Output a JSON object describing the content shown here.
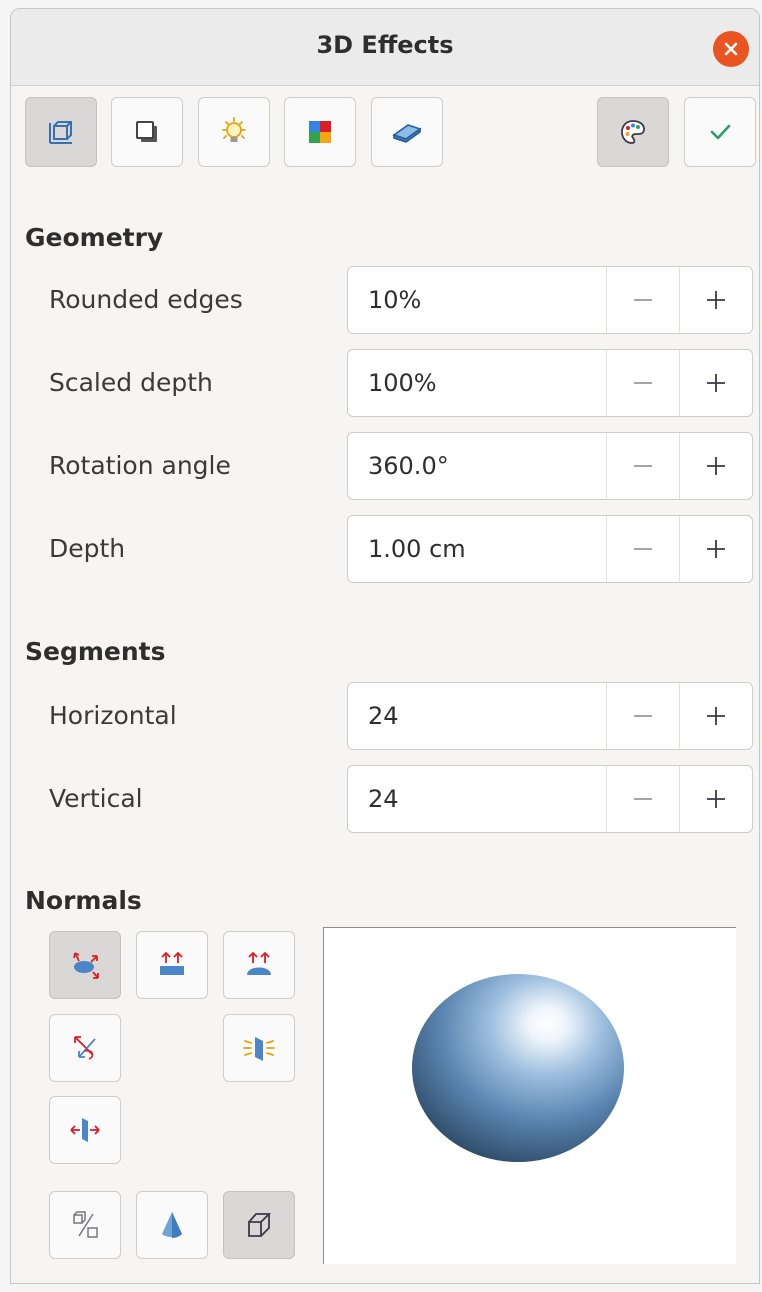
{
  "dialog": {
    "title": "3D Effects"
  },
  "toolbar": {
    "buttons": [
      {
        "name": "geometry",
        "icon": "geometry-icon",
        "active": true
      },
      {
        "name": "shading",
        "icon": "shading-icon",
        "active": false
      },
      {
        "name": "illumination",
        "icon": "lightbulb-icon",
        "active": false
      },
      {
        "name": "textures",
        "icon": "color-squares-icon",
        "active": false
      },
      {
        "name": "material",
        "icon": "material-icon",
        "active": false
      },
      {
        "name": "assign",
        "icon": "palette-icon",
        "active": true
      },
      {
        "name": "apply",
        "icon": "checkmark-icon",
        "active": false
      }
    ]
  },
  "geometry": {
    "heading": "Geometry",
    "fields": [
      {
        "label": "Rounded edges",
        "value": "10%"
      },
      {
        "label": "Scaled depth",
        "value": "100%"
      },
      {
        "label": "Rotation angle",
        "value": "360.0°"
      },
      {
        "label": "Depth",
        "value": "1.00 cm"
      }
    ]
  },
  "segments": {
    "heading": "Segments",
    "fields": [
      {
        "label": "Horizontal",
        "value": "24"
      },
      {
        "label": "Vertical",
        "value": "24"
      }
    ]
  },
  "normals": {
    "heading": "Normals",
    "buttons": [
      {
        "name": "object-specific",
        "icon": "object-specific-normals-icon",
        "active": true
      },
      {
        "name": "flat",
        "icon": "flat-normals-icon",
        "active": false
      },
      {
        "name": "spherical",
        "icon": "spherical-normals-icon",
        "active": false
      },
      {
        "name": "invert",
        "icon": "invert-normals-icon",
        "active": false
      },
      {
        "name": "double-sided-illumination",
        "icon": "double-sided-illumination-icon",
        "active": false
      },
      {
        "name": "double-sided",
        "icon": "double-sided-icon",
        "active": false
      },
      {
        "name": "convert-to-3d",
        "icon": "convert-to-3d-icon",
        "active": false
      },
      {
        "name": "lathe-object",
        "icon": "cone-icon",
        "active": false
      },
      {
        "name": "perspective",
        "icon": "perspective-cube-icon",
        "active": true
      }
    ]
  },
  "colors": {
    "accent_close": "#e95420",
    "checkmark": "#26a269",
    "arrow": "#e01b24",
    "blue": "#4a86c8"
  }
}
